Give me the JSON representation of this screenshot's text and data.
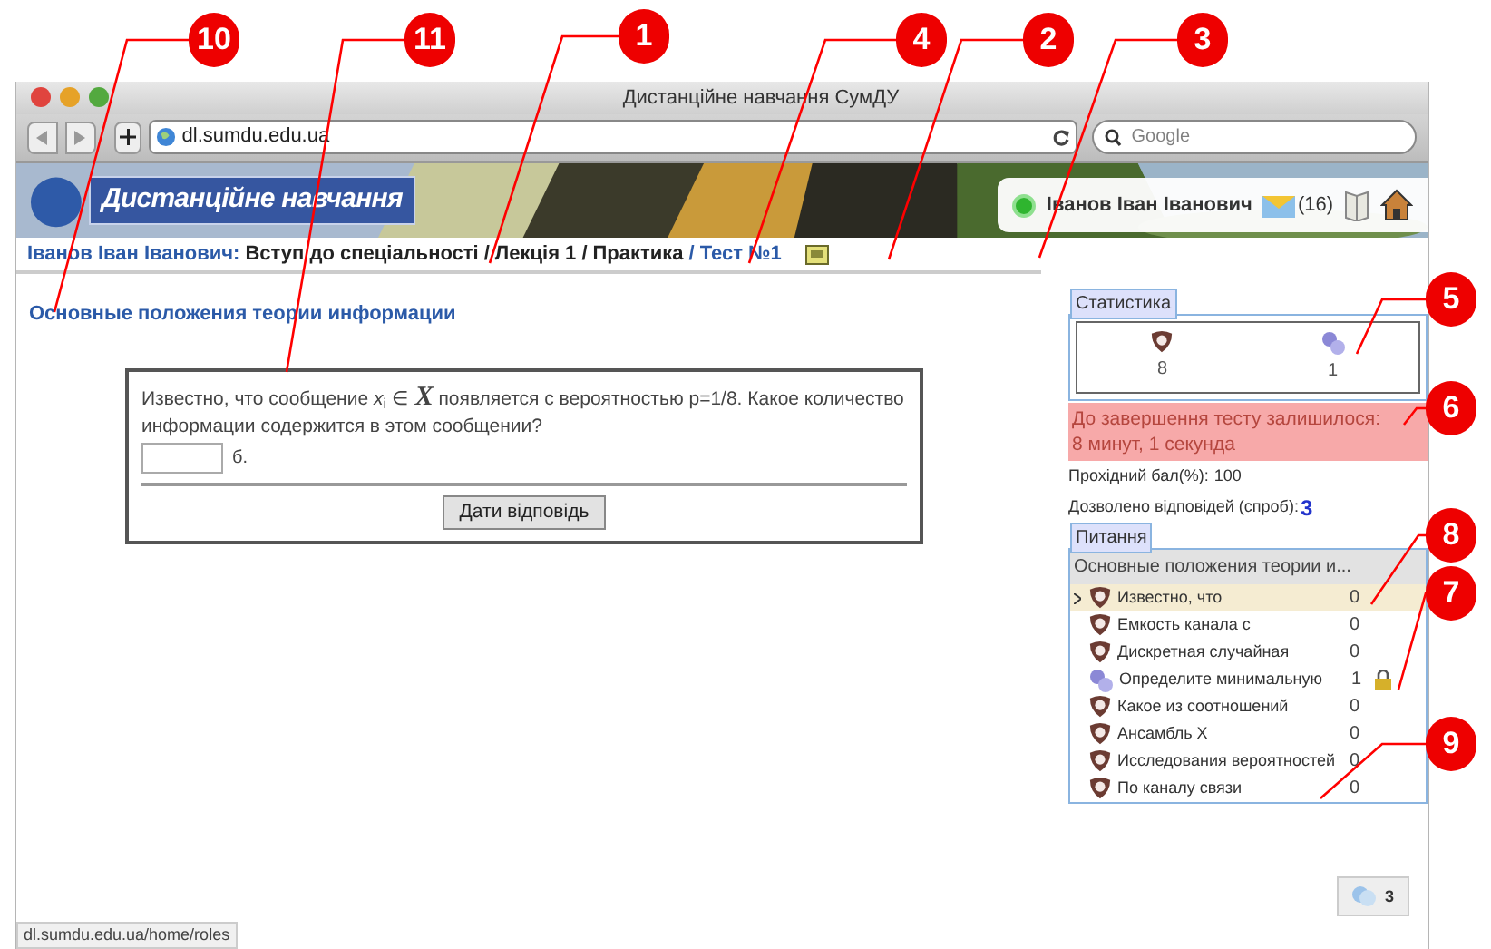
{
  "browser": {
    "title": "Дистанційне навчання СумДУ",
    "address": "dl.sumdu.edu.ua",
    "search_placeholder": "Google",
    "status_url": "dl.sumdu.edu.ua/home/roles"
  },
  "header": {
    "logo_text": "Дистанційне навчання",
    "user_name": "Іванов Іван Іванович",
    "messages": "(16)"
  },
  "breadcrumb": {
    "separator": "/",
    "items": [
      {
        "text": "Іванов Іван Іванович:",
        "kind": "user"
      },
      {
        "text": "Вступ до спеціальності",
        "kind": "plain"
      },
      {
        "text": "Лекція 1",
        "kind": "plain"
      },
      {
        "text": "Практика",
        "kind": "plain"
      },
      {
        "text": "Тест №1",
        "kind": "current"
      }
    ]
  },
  "section_title": "Основные положения теории информации",
  "question": {
    "text": "Известно, что сообщение  *x*$_{i}$ ∈ **X**  появляется с вероятностью p=1/8. Какое количество информации содержится в этом сообщении?",
    "unit": "б.",
    "button": "Дати відповідь"
  },
  "stats": {
    "title": "Статистика",
    "items": [
      {
        "kind": "answered",
        "count": "8"
      },
      {
        "kind": "unknown",
        "count": "1"
      }
    ]
  },
  "timer": {
    "text": "До завершення тесту залишилося:",
    "time": "8 минут, 1 секунда"
  },
  "pass_score": {
    "label": "Прохідний бал(%):",
    "value": "100"
  },
  "attempts": {
    "label": "Дозволено відповідей (спроб):",
    "value": "3"
  },
  "questions": {
    "title": "Питання",
    "group": "Основные положения теории и...",
    "items": [
      {
        "kind": "answered",
        "text": "Известно, что",
        "score": "0",
        "selected": true,
        "locked": false
      },
      {
        "kind": "answered",
        "text": "Емкость канала с",
        "score": "0",
        "selected": false,
        "locked": false
      },
      {
        "kind": "answered",
        "text": "Дискретная случайная",
        "score": "0",
        "selected": false,
        "locked": false
      },
      {
        "kind": "unknown",
        "text": "Определите минимальную",
        "score": "1",
        "selected": false,
        "locked": true
      },
      {
        "kind": "answered",
        "text": "Какое из соотношений",
        "score": "0",
        "selected": false,
        "locked": false
      },
      {
        "kind": "answered",
        "text": "Ансамбль X",
        "score": "0",
        "selected": false,
        "locked": false
      },
      {
        "kind": "answered",
        "text": "Исследования вероятностей",
        "score": "0",
        "selected": false,
        "locked": false
      },
      {
        "kind": "answered",
        "text": "По каналу связи",
        "score": "0",
        "selected": false,
        "locked": false
      }
    ]
  },
  "chat": {
    "count": "3"
  },
  "callouts": [
    {
      "label": "10"
    },
    {
      "label": "11"
    },
    {
      "label": "1"
    },
    {
      "label": "4"
    },
    {
      "label": "2"
    },
    {
      "label": "3"
    },
    {
      "label": "5"
    },
    {
      "label": "6"
    },
    {
      "label": "8"
    },
    {
      "label": "7"
    },
    {
      "label": "9"
    }
  ]
}
